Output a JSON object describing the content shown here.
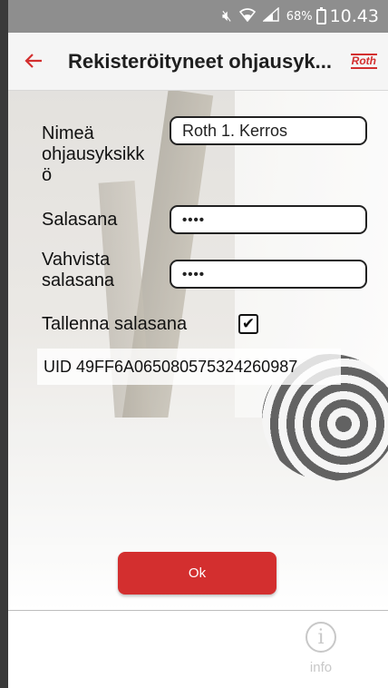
{
  "status_bar": {
    "battery_percent": "68%",
    "time": "10.43",
    "icons": [
      "mute-icon",
      "wifi-icon",
      "signal-icon",
      "battery-charging-icon"
    ]
  },
  "app_bar": {
    "title": "Rekisteröityneet ohjausyk...",
    "logo_text": "Roth"
  },
  "form": {
    "name_label": "Nimeä ohjausyksikk ö",
    "name_value": "Roth 1. Kerros",
    "password_label": "Salasana",
    "password_value": "••••",
    "confirm_label": "Vahvista salasana",
    "confirm_value": "••••",
    "save_password_label": "Tallenna salasana",
    "save_password_checked": true,
    "uid_text": "UID 49FF6A065080575324260987"
  },
  "ok_button": "Ok",
  "info_button": "info",
  "colors": {
    "accent": "#d32f2f",
    "status_bar": "#8e8e8e"
  }
}
